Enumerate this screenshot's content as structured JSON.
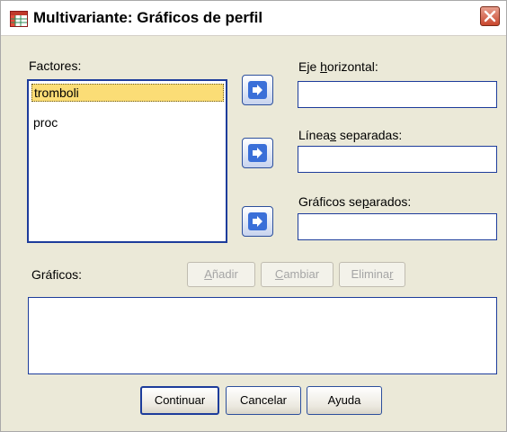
{
  "window": {
    "title": "Multivariante: Gráficos de perfil"
  },
  "factores": {
    "label": "Factores:",
    "items": [
      "tromboli",
      "proc"
    ]
  },
  "eje_horizontal": {
    "label_pre": "Eje ",
    "label_u": "h",
    "label_post": "orizontal:",
    "value": ""
  },
  "lineas_separadas": {
    "label_pre": "Línea",
    "label_u": "s",
    "label_post": " separadas:",
    "value": ""
  },
  "graficos_separados": {
    "label_pre": "Gráficos se",
    "label_u": "p",
    "label_post": "arados:",
    "value": ""
  },
  "graficos": {
    "label": "Gráficos:",
    "add": {
      "pre": "",
      "u": "A",
      "post": "ñadir"
    },
    "change": {
      "pre": "",
      "u": "C",
      "post": "ambiar"
    },
    "remove": {
      "pre": "Elimina",
      "u": "r",
      "post": ""
    }
  },
  "footer": {
    "continue": "Continuar",
    "cancel": "Cancelar",
    "help": "Ayuda"
  },
  "colors": {
    "selection": "#fbdd76",
    "accent": "#1d3c9b",
    "close": "#c9472e"
  },
  "icons": {
    "app": "spreadsheet-icon",
    "close": "close-icon",
    "move": "arrow-right-icon"
  }
}
